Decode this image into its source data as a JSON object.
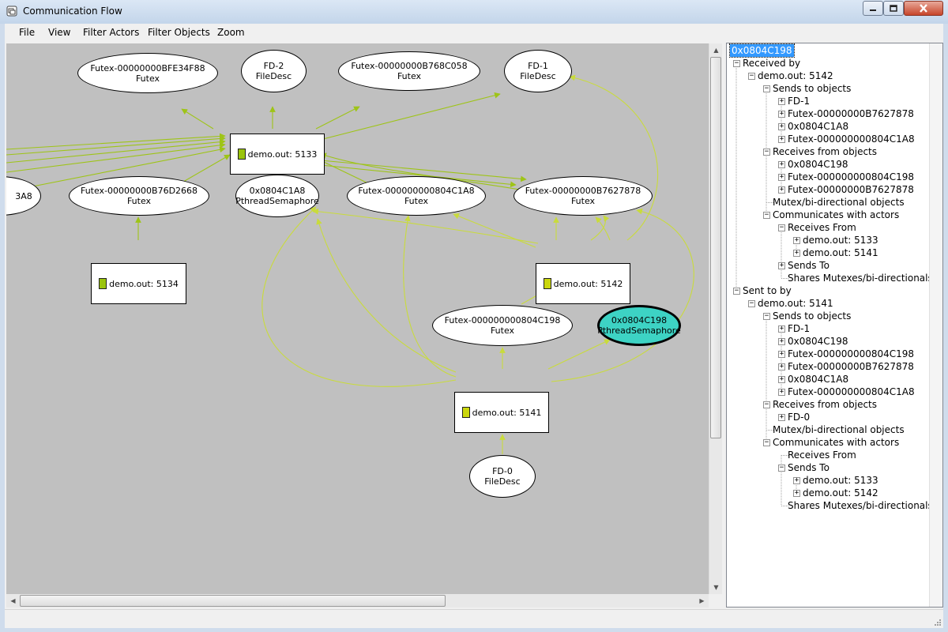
{
  "window": {
    "title": "Communication Flow"
  },
  "menu": [
    "File",
    "View",
    "Filter Actors",
    "Filter Objects",
    "Zoom"
  ],
  "colors": {
    "canvas": "#c0c0c0",
    "edge": "#9ec417",
    "edge_light": "#c9db3c",
    "selected_node": "#3dd3c4",
    "actor_swatch": "#9ac40c",
    "actor_swatch_alt": "#cbd70d",
    "tree_selection": "#3399ff"
  },
  "graph": {
    "object_nodes": [
      {
        "id": "futex-bfe",
        "line1": "Futex-00000000BFE34F88",
        "line2": "Futex"
      },
      {
        "id": "fd2",
        "line1": "FD-2",
        "line2": "FileDesc"
      },
      {
        "id": "futex-b768",
        "line1": "Futex-00000000B768C058",
        "line2": "Futex"
      },
      {
        "id": "fd1",
        "line1": "FD-1",
        "line2": "FileDesc"
      },
      {
        "id": "a8-partial",
        "line1": "3A8",
        "line2": ""
      },
      {
        "id": "futex-b76d",
        "line1": "Futex-00000000B76D2668",
        "line2": "Futex"
      },
      {
        "id": "sem-1a8",
        "line1": "0x0804C1A8",
        "line2": "PthreadSemaphore"
      },
      {
        "id": "futex-804c1a8",
        "line1": "Futex-000000000804C1A8",
        "line2": "Futex"
      },
      {
        "id": "futex-b762",
        "line1": "Futex-00000000B7627878",
        "line2": "Futex"
      },
      {
        "id": "futex-804c198",
        "line1": "Futex-000000000804C198",
        "line2": "Futex"
      },
      {
        "id": "sem-198",
        "line1": "0x0804C198",
        "line2": "PthreadSemaphore",
        "selected": true
      },
      {
        "id": "fd0",
        "line1": "FD-0",
        "line2": "FileDesc"
      }
    ],
    "actor_nodes": [
      {
        "id": "a5133",
        "label": "demo.out: 5133"
      },
      {
        "id": "a5134",
        "label": "demo.out: 5134"
      },
      {
        "id": "a5142",
        "label": "demo.out: 5142"
      },
      {
        "id": "a5141",
        "label": "demo.out: 5141"
      }
    ]
  },
  "tree": {
    "root": "0x0804C198",
    "rows": [
      {
        "text": "0x0804C198",
        "level": 0,
        "exp": "",
        "selected": true
      },
      {
        "text": "Received by",
        "level": 0,
        "exp": "-"
      },
      {
        "text": "demo.out: 5142",
        "level": 1,
        "exp": "-"
      },
      {
        "text": "Sends to objects",
        "level": 2,
        "exp": "-"
      },
      {
        "text": "FD-1",
        "level": 3,
        "exp": "+"
      },
      {
        "text": "Futex-00000000B7627878",
        "level": 3,
        "exp": "+"
      },
      {
        "text": "0x0804C1A8",
        "level": 3,
        "exp": "+"
      },
      {
        "text": "Futex-000000000804C1A8",
        "level": 3,
        "exp": "+"
      },
      {
        "text": "Receives from objects",
        "level": 2,
        "exp": "-"
      },
      {
        "text": "0x0804C198",
        "level": 3,
        "exp": "+"
      },
      {
        "text": "Futex-000000000804C198",
        "level": 3,
        "exp": "+"
      },
      {
        "text": "Futex-00000000B7627878",
        "level": 3,
        "exp": "+"
      },
      {
        "text": "Mutex/bi-directional objects",
        "level": 2,
        "exp": ""
      },
      {
        "text": "Communicates with actors",
        "level": 2,
        "exp": "-"
      },
      {
        "text": "Receives From",
        "level": 3,
        "exp": "-"
      },
      {
        "text": "demo.out: 5133",
        "level": 4,
        "exp": "+"
      },
      {
        "text": "demo.out: 5141",
        "level": 4,
        "exp": "+"
      },
      {
        "text": "Sends To",
        "level": 3,
        "exp": "+"
      },
      {
        "text": "Shares Mutexes/bi-directionals with",
        "level": 3,
        "exp": ""
      },
      {
        "text": "Sent to by",
        "level": 0,
        "exp": "-"
      },
      {
        "text": "demo.out: 5141",
        "level": 1,
        "exp": "-"
      },
      {
        "text": "Sends to objects",
        "level": 2,
        "exp": "-"
      },
      {
        "text": "FD-1",
        "level": 3,
        "exp": "+"
      },
      {
        "text": "0x0804C198",
        "level": 3,
        "exp": "+"
      },
      {
        "text": "Futex-000000000804C198",
        "level": 3,
        "exp": "+"
      },
      {
        "text": "Futex-00000000B7627878",
        "level": 3,
        "exp": "+"
      },
      {
        "text": "0x0804C1A8",
        "level": 3,
        "exp": "+"
      },
      {
        "text": "Futex-000000000804C1A8",
        "level": 3,
        "exp": "+"
      },
      {
        "text": "Receives from objects",
        "level": 2,
        "exp": "-"
      },
      {
        "text": "FD-0",
        "level": 3,
        "exp": "+"
      },
      {
        "text": "Mutex/bi-directional objects",
        "level": 2,
        "exp": ""
      },
      {
        "text": "Communicates with actors",
        "level": 2,
        "exp": "-"
      },
      {
        "text": "Receives From",
        "level": 3,
        "exp": ""
      },
      {
        "text": "Sends To",
        "level": 3,
        "exp": "-"
      },
      {
        "text": "demo.out: 5133",
        "level": 4,
        "exp": "+"
      },
      {
        "text": "demo.out: 5142",
        "level": 4,
        "exp": "+"
      },
      {
        "text": "Shares Mutexes/bi-directionals with",
        "level": 3,
        "exp": ""
      }
    ]
  }
}
